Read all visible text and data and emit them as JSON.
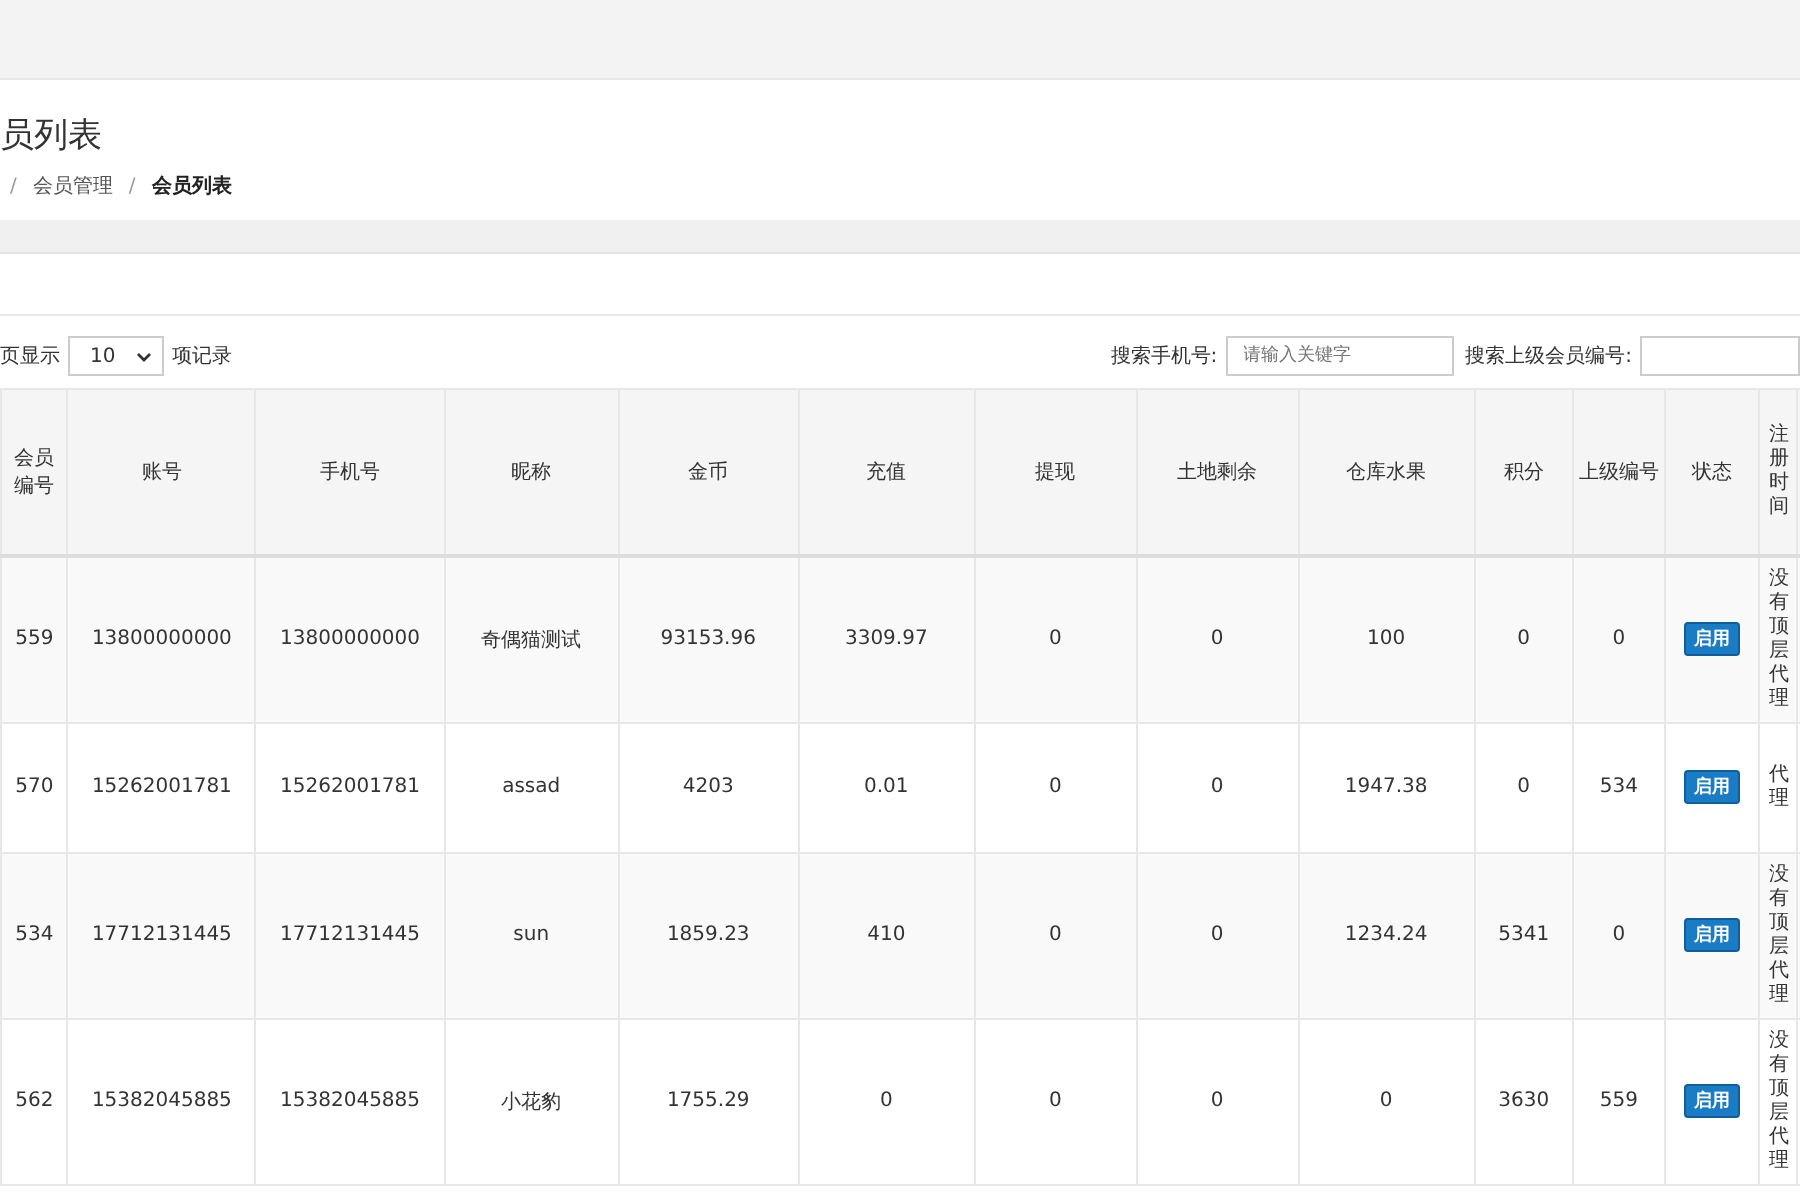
{
  "page_title": "员列表",
  "breadcrumb": [
    {
      "separator": "/",
      "label": "会员管理",
      "current": false
    },
    {
      "separator": "/",
      "label": "会员列表",
      "current": true
    }
  ],
  "length_control": {
    "before": "页显示",
    "value": "10",
    "after": "项记录"
  },
  "search": [
    {
      "label": "搜索手机号:",
      "placeholder": "请输入关键字"
    },
    {
      "label": "搜索上级会员编号:"
    }
  ],
  "table": {
    "columns": [
      "会员编号",
      "账号",
      "手机号",
      "昵称",
      "金币",
      "充值",
      "提现",
      "土地剩余",
      "仓库水果",
      "积分",
      "上级编号",
      "状态",
      "注册时间"
    ],
    "rows": [
      {
        "cells": [
          "559",
          "13800000000",
          "13800000000",
          "奇偶猫测试",
          "93153.96",
          "3309.97",
          "0",
          "0",
          "100",
          "0",
          "0"
        ],
        "status": {
          "label": "启用",
          "enabled": true
        },
        "register": "没有顶层代理"
      },
      {
        "cells": [
          "570",
          "15262001781",
          "15262001781",
          "assad",
          "4203",
          "0.01",
          "0",
          "0",
          "1947.38",
          "0",
          "534"
        ],
        "status": {
          "label": "启用",
          "enabled": true
        },
        "register": "代理"
      },
      {
        "cells": [
          "534",
          "17712131445",
          "17712131445",
          "sun",
          "1859.23",
          "410",
          "0",
          "0",
          "1234.24",
          "5341",
          "0"
        ],
        "status": {
          "label": "启用",
          "enabled": true
        },
        "register": "没有顶层代理"
      },
      {
        "cells": [
          "562",
          "15382045885",
          "15382045885",
          "小花豹",
          "1755.29",
          "0",
          "0",
          "0",
          "0",
          "3630",
          "559"
        ],
        "status": {
          "label": "启用",
          "enabled": true
        },
        "register": "没有顶层代理"
      }
    ]
  }
}
